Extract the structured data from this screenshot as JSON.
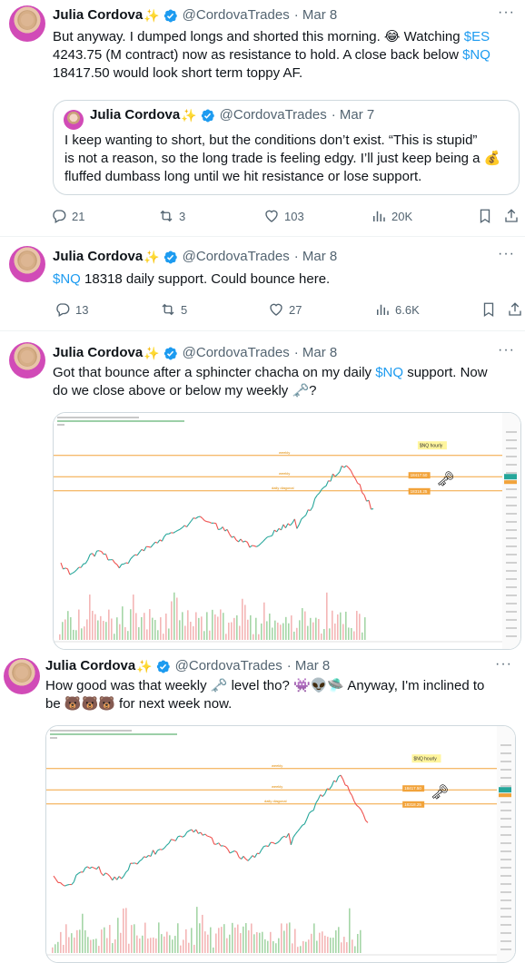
{
  "tweets": [
    {
      "name": "Julia Cordova",
      "sparkle": "✨",
      "handle": "@CordovaTrades",
      "date": "· Mar 8",
      "text": {
        "l1a": "But anyway.  I dumped longs and shorted this morning. 😂 Watching ",
        "l1b": "$ES",
        "l2": "4243.75 (M contract) now as resistance to hold.  A close back below ",
        "l2b": "$NQ",
        "l3": "18417.50 would look short term toppy AF."
      },
      "quote": {
        "name": "Julia Cordova",
        "sparkle": "✨",
        "handle": "@CordovaTrades",
        "date": "· Mar 7",
        "l1": "I keep wanting to short, but the conditions don’t exist. “This is stupid”",
        "l2": "is not a reason, so the long trade is feeling edgy. I’ll just keep being a 💰",
        "l3": "fluffed dumbass long until we hit resistance or lose support."
      },
      "replies": "21",
      "reposts": "3",
      "likes": "103",
      "views": "20K"
    },
    {
      "name": "Julia Cordova",
      "sparkle": "✨",
      "handle": "@CordovaTrades",
      "date": "· Mar 8",
      "text": {
        "cash": "$NQ",
        "rest": " 18318 daily support.  Could bounce here."
      },
      "replies": "13",
      "reposts": "5",
      "likes": "27",
      "views": "6.6K"
    },
    {
      "name": "Julia Cordova",
      "sparkle": "✨",
      "handle": "@CordovaTrades",
      "date": "· Mar 8",
      "text": {
        "l1a": "Got that bounce after a sphincter chacha on my daily ",
        "l1b": "$NQ",
        "l1c": " support.  Now",
        "l2": "do we close above or below my weekly 🗝️?"
      },
      "chart": {
        "badge": "$NQ hourly",
        "tag1": "18417.50",
        "tag2": "18318.25",
        "line1": "weekly",
        "line2": "weekly",
        "line3": "daily diagonal"
      }
    },
    {
      "name": "Julia Cordova",
      "sparkle": "✨",
      "handle": "@CordovaTrades",
      "date": "· Mar 8",
      "text": {
        "l1": "How good was that weekly 🗝️ level tho? 👾👽🛸 Anyway, I'm inclined to",
        "l2": "be 🐻🐻🐻 for next week now."
      },
      "chart": {
        "badge": "$NQ hourly",
        "tag1": "18417.50",
        "tag2": "18318.25",
        "line1": "weekly",
        "line2": "weekly",
        "line3": "daily diagonal"
      }
    }
  ],
  "icons": {
    "more": "more-icon",
    "verified": "verified-badge-icon",
    "reply": "reply-icon",
    "repost": "repost-icon",
    "like": "heart-icon",
    "views": "views-icon",
    "bookmark": "bookmark-icon",
    "share": "share-icon"
  },
  "colors": {
    "link": "#1d9bf0",
    "verified": "#1d9bf0",
    "muted": "#536471",
    "border": "#cfd9de"
  }
}
